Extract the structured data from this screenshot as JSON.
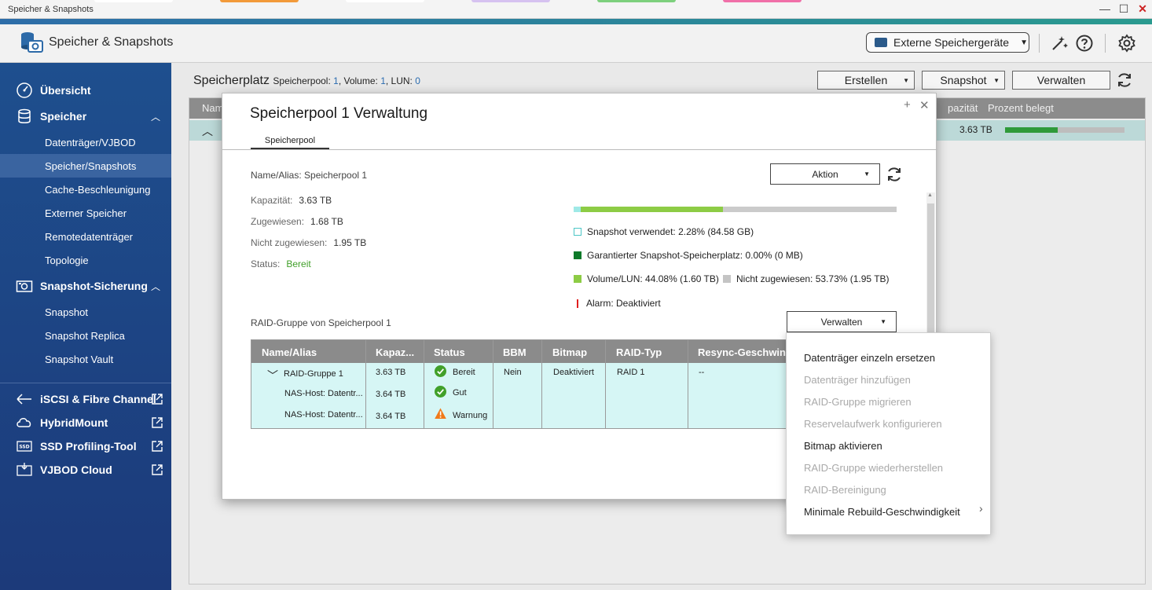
{
  "window": {
    "title": "Speicher & Snapshots",
    "controls": {
      "minimize": "—",
      "maximize": "☐",
      "close": "✕"
    },
    "tabstrip_colors": [
      "#ffffff",
      "#f29a3a",
      "#ffffff",
      "#d6c2f0",
      "#7dd07d",
      "#f06fa8"
    ]
  },
  "header": {
    "app_title": "Speicher & Snapshots",
    "external_button": "Externe Speichergeräte"
  },
  "sidebar": {
    "items": [
      {
        "label": "Übersicht",
        "icon": "gauge-icon"
      },
      {
        "label": "Speicher",
        "icon": "database-icon",
        "chevron": "︿"
      },
      {
        "label": "Datenträger/VJBOD"
      },
      {
        "label": "Speicher/Snapshots"
      },
      {
        "label": "Cache-Beschleunigung"
      },
      {
        "label": "Externer Speicher"
      },
      {
        "label": "Remotedatenträger"
      },
      {
        "label": "Topologie"
      },
      {
        "label": "Snapshot-Sicherung",
        "icon": "camera-icon",
        "chevron": "︿"
      },
      {
        "label": "Snapshot"
      },
      {
        "label": "Snapshot Replica"
      },
      {
        "label": "Snapshot Vault"
      },
      {
        "label": "iSCSI & Fibre Channel",
        "icon": "iscsi-icon"
      },
      {
        "label": "HybridMount",
        "icon": "cloud-icon"
      },
      {
        "label": "SSD Profiling-Tool",
        "icon": "ssd-icon"
      },
      {
        "label": "VJBOD Cloud",
        "icon": "vjbod-cloud-icon"
      }
    ]
  },
  "main": {
    "heading": "Speicherplatz",
    "summary_prefix_pool": "Speicherpool: ",
    "pool_count": "1",
    "summary_prefix_volume": ", Volume: ",
    "volume_count": "1",
    "summary_prefix_lun": ", LUN: ",
    "lun_count": "0",
    "buttons": {
      "create": "Erstellen",
      "snapshot": "Snapshot",
      "manage": "Verwalten"
    },
    "table_head_left": "Nam",
    "table_head_capacity": "pazität",
    "table_head_percent": "Prozent belegt",
    "row_capacity": "3.63 TB",
    "row_percent_used": 0.44
  },
  "modal": {
    "title": "Speicherpool 1 Verwaltung",
    "tab": "Speicherpool",
    "name_alias_label": "Name/Alias: Speicherpool 1",
    "action_button": "Aktion",
    "capacity_label": "Kapazität:",
    "capacity_value": "3.63 TB",
    "assigned_label": "Zugewiesen:",
    "assigned_value": "1.68 TB",
    "unassigned_label": "Nicht zugewiesen:",
    "unassigned_value": "1.95 TB",
    "status_label": "Status:",
    "status_value": "Bereit",
    "usage": {
      "snapshot_fraction": 0.0228,
      "volume_fraction": 0.4408,
      "legend_snapshot": "Snapshot verwendet: 2.28% (84.58 GB)",
      "legend_guaranteed": "Garantierter Snapshot-Speicherplatz: 0.00% (0 MB)",
      "legend_volume": "Volume/LUN: 44.08% (1.60 TB)",
      "legend_unassigned": "Nicht zugewiesen: 53.73% (1.95 TB)",
      "legend_alarm": "Alarm: Deaktiviert"
    },
    "raid_group_label": "RAID-Gruppe von Speicherpool 1",
    "manage_button": "Verwalten",
    "raid_table": {
      "headers": [
        "Name/Alias",
        "Kapaz...",
        "Status",
        "BBM",
        "Bitmap",
        "RAID-Typ",
        "Resync-Geschwindi"
      ],
      "rows": [
        {
          "name": "RAID-Gruppe 1",
          "capacity": "3.63 TB",
          "status": "Bereit",
          "status_icon": "check-icon",
          "bbm": "Nein",
          "bitmap": "Deaktiviert",
          "raid_type": "RAID 1",
          "resync": "--"
        },
        {
          "name": "NAS-Host: Datentr...",
          "capacity": "3.64 TB",
          "status": "Gut",
          "status_icon": "check-icon"
        },
        {
          "name": "NAS-Host: Datentr...",
          "capacity": "3.64 TB",
          "status": "Warnung",
          "status_icon": "warning-icon"
        }
      ]
    },
    "context_menu": [
      {
        "label": "Datenträger einzeln ersetzen",
        "enabled": true
      },
      {
        "label": "Datenträger hinzufügen",
        "enabled": false
      },
      {
        "label": "RAID-Gruppe migrieren",
        "enabled": false
      },
      {
        "label": "Reservelaufwerk konfigurieren",
        "enabled": false
      },
      {
        "label": "Bitmap aktivieren",
        "enabled": true
      },
      {
        "label": "RAID-Gruppe wiederherstellen",
        "enabled": false
      },
      {
        "label": "RAID-Bereinigung",
        "enabled": false
      },
      {
        "label": "Minimale Rebuild-Geschwindigkeit",
        "enabled": true,
        "submenu": true
      }
    ]
  },
  "colors": {
    "sidebar_bg": "#1e4f8e",
    "accent_teal": "#2a9a8f",
    "ok_green": "#41a02a",
    "volume_green": "#8dcc45",
    "guaranteed_green": "#0e7a2a",
    "snapshot_cyan": "#4cc6c6",
    "warning_orange": "#f07a1a",
    "alarm_red": "#e02020"
  }
}
